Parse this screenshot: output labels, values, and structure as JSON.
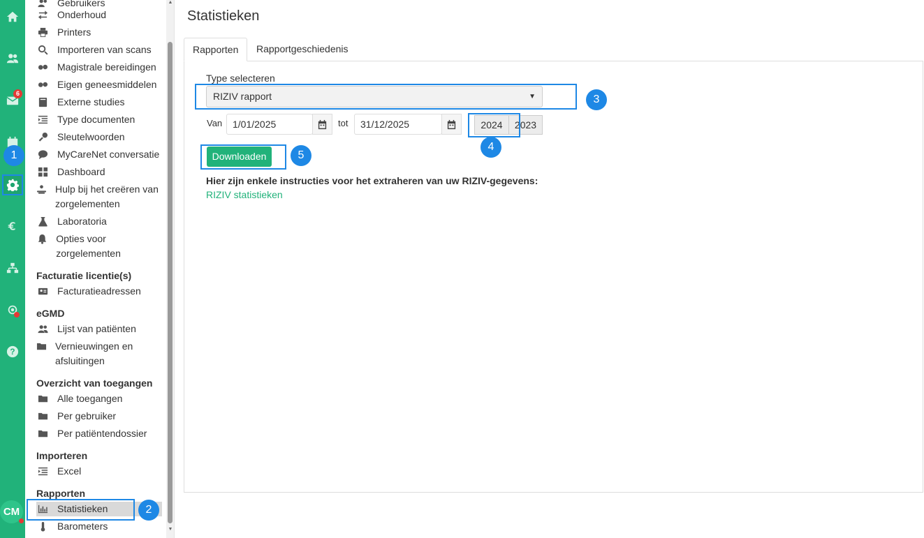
{
  "rail": {
    "mail_badge_count": "6",
    "avatar_initials": "CM"
  },
  "sidebar": {
    "items_top": [
      {
        "label": "Gebruikers",
        "icon": "users-icon"
      },
      {
        "label": "Onderhoud",
        "icon": "arrows-icon"
      },
      {
        "label": "Printers",
        "icon": "printer-icon"
      },
      {
        "label": "Importeren van scans",
        "icon": "search-icon"
      },
      {
        "label": "Magistrale bereidingen",
        "icon": "pills-icon"
      },
      {
        "label": "Eigen geneesmiddelen",
        "icon": "pills-icon"
      },
      {
        "label": "Externe studies",
        "icon": "book-icon"
      },
      {
        "label": "Type documenten",
        "icon": "list-icon"
      },
      {
        "label": "Sleutelwoorden",
        "icon": "key-icon"
      },
      {
        "label": "MyCareNet conversatie",
        "icon": "chat-icon"
      },
      {
        "label": "Dashboard",
        "icon": "grid-icon"
      },
      {
        "label": "Hulp bij het creëren van zorgelementen",
        "icon": "hands-icon"
      },
      {
        "label": "Laboratoria",
        "icon": "flask-icon"
      },
      {
        "label": "Opties voor zorgelementen",
        "icon": "bell-icon"
      }
    ],
    "sections": {
      "facturatie": {
        "title": "Facturatie licentie(s)",
        "items": [
          "Facturatieadressen"
        ]
      },
      "egmd": {
        "title": "eGMD",
        "items": [
          "Lijst van patiënten",
          "Vernieuwingen en afsluitingen"
        ]
      },
      "toegangen": {
        "title": "Overzicht van toegangen",
        "items": [
          "Alle toegangen",
          "Per gebruiker",
          "Per patiëntendossier"
        ]
      },
      "importeren": {
        "title": "Importeren",
        "items": [
          "Excel"
        ]
      },
      "rapporten": {
        "title": "Rapporten",
        "items": [
          "Statistieken",
          "Barometers"
        ]
      }
    }
  },
  "main": {
    "title": "Statistieken",
    "tabs": [
      "Rapporten",
      "Rapportgeschiedenis"
    ],
    "type_label": "Type selecteren",
    "type_value": "RIZIV rapport",
    "from_label": "Van",
    "from_value": "1/01/2025",
    "to_label": "tot",
    "to_value": "31/12/2025",
    "year_buttons": [
      "2024",
      "2023"
    ],
    "download_label": "Downloaden",
    "instructions": "Hier zijn enkele instructies voor het extraheren van uw RIZIV-gegevens:",
    "link_label": "RIZIV statistieken"
  },
  "annotations": [
    "1",
    "2",
    "3",
    "4",
    "5"
  ],
  "colors": {
    "brand": "#21b27a",
    "annotation": "#1e88e5",
    "badge": "#e53935"
  }
}
